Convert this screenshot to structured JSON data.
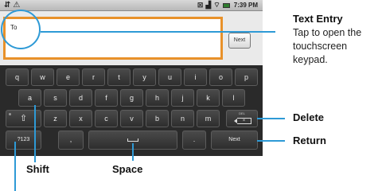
{
  "status_bar": {
    "left_icons": [
      "usb-icon",
      "alert-icon"
    ],
    "right_icons": [
      "network-icon",
      "signal-icon",
      "wifi-icon",
      "battery-icon"
    ],
    "time": "7:39 PM"
  },
  "compose": {
    "to_label": "To",
    "next_label": "Next"
  },
  "keyboard": {
    "row1": [
      "q",
      "w",
      "e",
      "r",
      "t",
      "y",
      "u",
      "i",
      "o",
      "p"
    ],
    "row2": [
      "a",
      "s",
      "d",
      "f",
      "g",
      "h",
      "j",
      "k",
      "l"
    ],
    "row3": [
      "z",
      "x",
      "c",
      "v",
      "b",
      "n",
      "m"
    ],
    "symbols_label": "?123",
    "comma_label": ",",
    "period_label": ".",
    "return_label": "Next",
    "delete_small_label": "DEL"
  },
  "callouts": {
    "text_entry_title": "Text Entry",
    "text_entry_line1": "Tap to open the",
    "text_entry_line2": "touchscreen",
    "text_entry_line3": "keypad.",
    "delete": "Delete",
    "return": "Return",
    "shift": "Shift",
    "space": "Space"
  },
  "colors": {
    "accent_callout": "#2e9ad6",
    "field_border": "#e8912a"
  }
}
